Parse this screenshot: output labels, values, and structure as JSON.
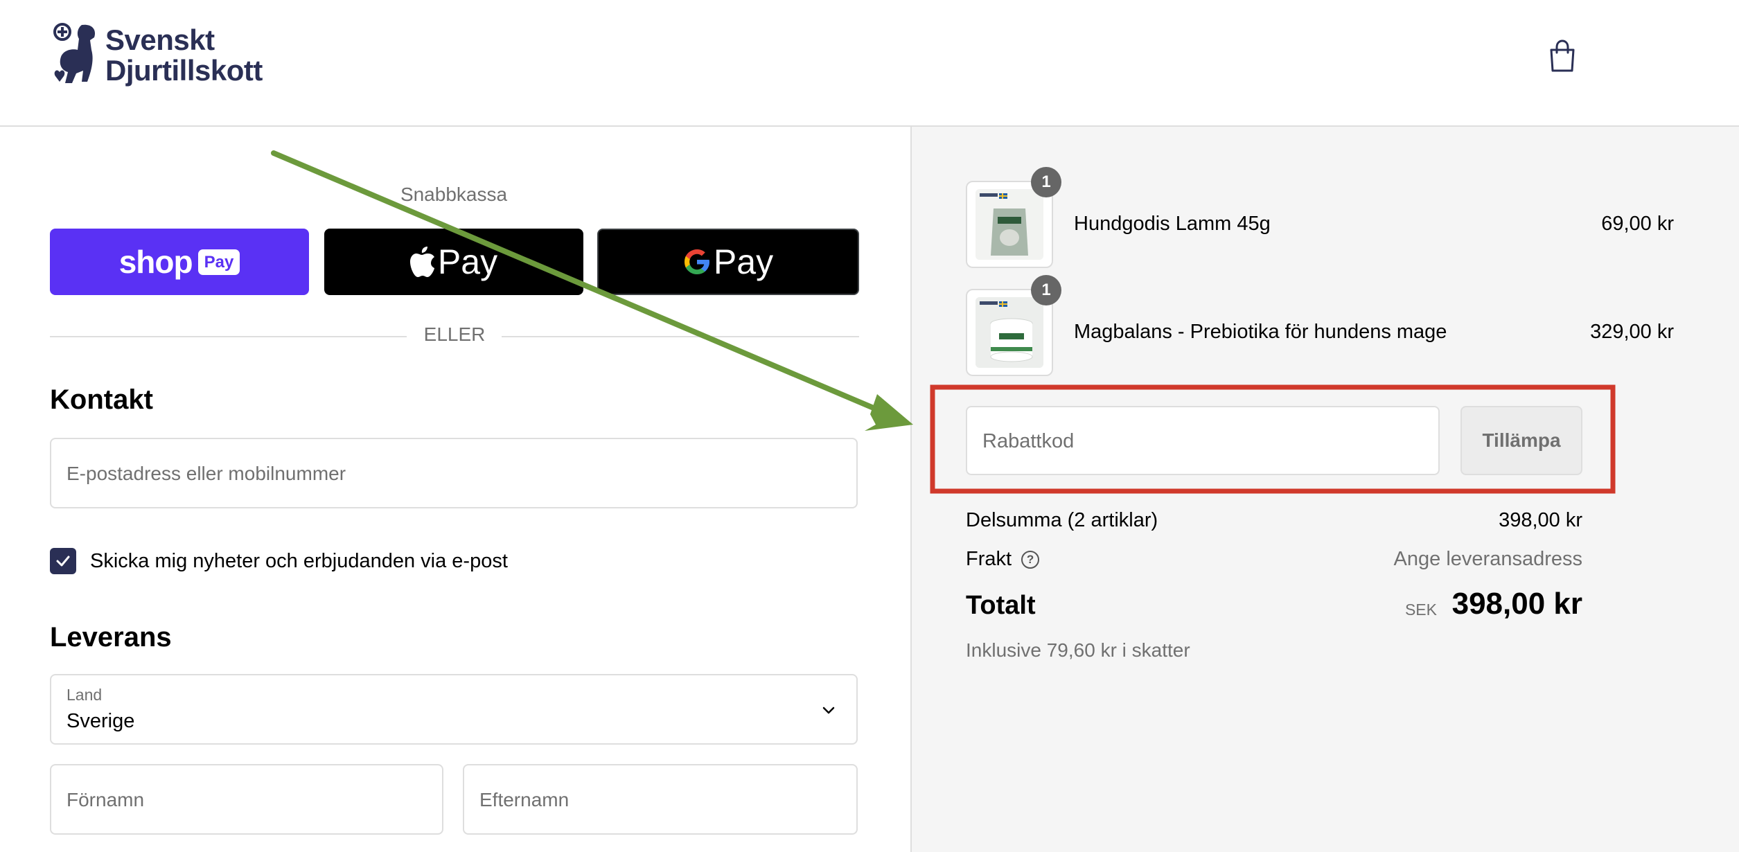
{
  "brand": {
    "line1": "Svenskt",
    "line2": "Djurtillskott"
  },
  "header": {
    "cart_icon": "shopping-bag-icon"
  },
  "express": {
    "title": "Snabbkassa",
    "shop_pay": {
      "word": "shop",
      "pill": "Pay"
    },
    "apple_pay": {
      "label": "Pay"
    },
    "google_pay": {
      "label": "Pay"
    },
    "divider": "ELLER"
  },
  "contact": {
    "heading": "Kontakt",
    "email_placeholder": "E-postadress eller mobilnummer",
    "newsletter_label": "Skicka mig nyheter och erbjudanden via e-post",
    "newsletter_checked": true
  },
  "delivery": {
    "heading": "Leverans",
    "country_label": "Land",
    "country_value": "Sverige",
    "first_name_placeholder": "Förnamn",
    "last_name_placeholder": "Efternamn"
  },
  "cart": {
    "items": [
      {
        "name": "Hundgodis Lamm 45g",
        "price": "69,00 kr",
        "qty": "1"
      },
      {
        "name": "Magbalans - Prebiotika för hundens mage",
        "price": "329,00 kr",
        "qty": "1"
      }
    ],
    "discount_placeholder": "Rabattkod",
    "apply_label": "Tillämpa",
    "subtotal_label": "Delsumma (2 artiklar)",
    "subtotal_value": "398,00 kr",
    "shipping_label": "Frakt",
    "shipping_value": "Ange leveransadress",
    "total_label": "Totalt",
    "currency": "SEK",
    "total_value": "398,00 kr",
    "tax_note": "Inklusive 79,60 kr i skatter"
  },
  "colors": {
    "shop_pay": "#5a31f4",
    "brand_navy": "#2a2f55",
    "annotation_arrow": "#6c9a3c",
    "annotation_box": "#d0392b"
  }
}
